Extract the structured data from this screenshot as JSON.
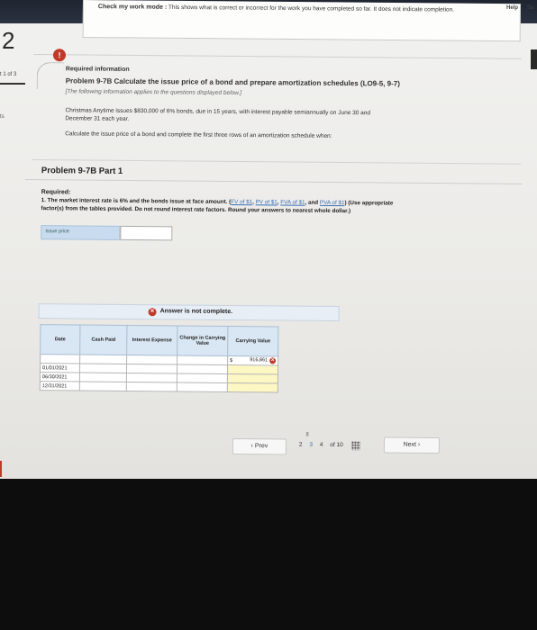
{
  "banner": {
    "mode_label": "Check my work mode :",
    "mode_text": "This shows what is correct or incorrect for the work you have completed so far. It does not indicate completion.",
    "help": "Help",
    "save": "Sa"
  },
  "left_rail": {
    "question_number": "2",
    "part_count": "t 1 of 3",
    "points": "ts"
  },
  "requirement": {
    "alert_symbol": "!",
    "heading": "Required information",
    "problem": "Problem 9-7B Calculate the issue price of a bond and prepare amortization schedules (LO9-5, 9-7)",
    "note": "[The following information applies to the questions displayed below.]",
    "text_line1": "Christmas Anytime issues $830,000 of 6% bonds, due in 15 years, with interest payable semiannually on June 30 and",
    "text_line2": "December 31 each year.",
    "text_line3": "Calculate the issue price of a bond and complete the first three rows of an amortization schedule when:"
  },
  "part": {
    "title": "Problem 9-7B Part 1",
    "required_label": "Required:",
    "instruction_start": "1. The market interest rate is 6% and the bonds issue at face amount. (",
    "factor_links": [
      "FV of $1",
      "PV of $1",
      "FVA of $1",
      "PVA of $1"
    ],
    "instruction_and": "and",
    "instruction_end": ") (Use appropriate",
    "instruction_line2": "factor(s) from the tables provided. Do not round interest rate factors. Round your answers to nearest whole dollar.)",
    "issue_price_label": "Issue price",
    "issue_price_value": ""
  },
  "answer": {
    "status_symbol": "✕",
    "status_text": "Answer is not complete."
  },
  "table": {
    "headers": [
      "Date",
      "Cash Paid",
      "Interest Expense",
      "Change in Carrying Value",
      "Carrying Value"
    ],
    "rows": [
      {
        "date": "",
        "cash_paid": "",
        "interest": "",
        "change": "",
        "currency": "$",
        "carrying": "916,861"
      },
      {
        "date": "01/01/2021",
        "cash_paid": "",
        "interest": "",
        "change": "",
        "currency": "",
        "carrying": ""
      },
      {
        "date": "06/30/2021",
        "cash_paid": "",
        "interest": "",
        "change": "",
        "currency": "",
        "carrying": ""
      },
      {
        "date": "12/31/2021",
        "cash_paid": "",
        "interest": "",
        "change": "",
        "currency": "",
        "carrying": ""
      }
    ]
  },
  "pager": {
    "prev_label": "Prev",
    "pages": [
      "2",
      "3",
      "4"
    ],
    "of_label": "of 10",
    "next_label": "Next"
  },
  "icons": {
    "prev": "chevron-left-icon",
    "next": "chevron-right-icon",
    "grid": "grid-icon",
    "links": "link-icon"
  },
  "colors": {
    "error": "#c0392b",
    "link": "#3b6fb5",
    "header_blue": "#d9e6f3",
    "input_yellow": "#fdf7c4"
  }
}
